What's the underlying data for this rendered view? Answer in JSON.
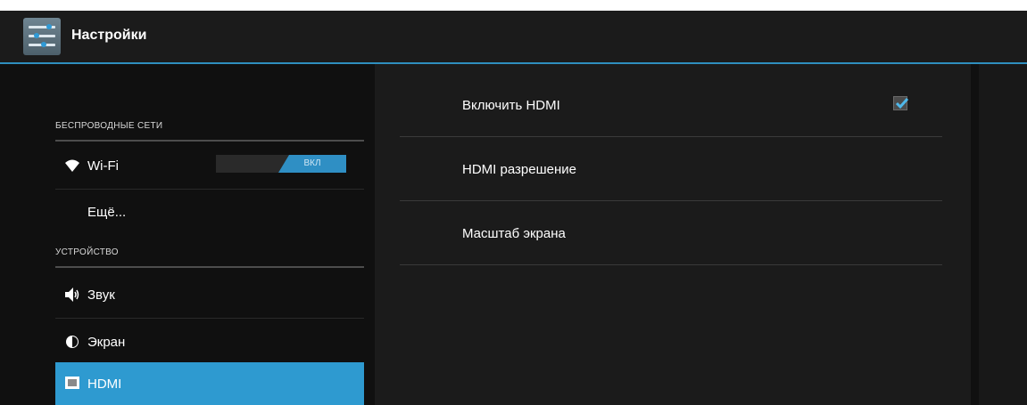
{
  "app": {
    "title": "Настройки",
    "icon": "settings-sliders-icon",
    "accent_color": "#2f8fbf"
  },
  "sidebar": {
    "sections": [
      {
        "header": "БЕСПРОВОДНЫЕ СЕТИ",
        "items": [
          {
            "label": "Wi-Fi",
            "icon": "wifi-icon",
            "toggle": {
              "state_label": "ВКЛ",
              "on": true
            }
          },
          {
            "label": "Ещё...",
            "icon": ""
          }
        ]
      },
      {
        "header": "УСТРОЙСТВО",
        "items": [
          {
            "label": "Звук",
            "icon": "speaker-icon"
          },
          {
            "label": "Экран",
            "icon": "brightness-icon"
          },
          {
            "label": "HDMI",
            "icon": "hdmi-icon",
            "selected": true
          }
        ]
      }
    ]
  },
  "main": {
    "preferences": [
      {
        "title": "Включить HDMI",
        "checkbox": {
          "checked": true
        }
      },
      {
        "title": "HDMI разрешение"
      },
      {
        "title": "Масштаб экрана"
      }
    ]
  }
}
